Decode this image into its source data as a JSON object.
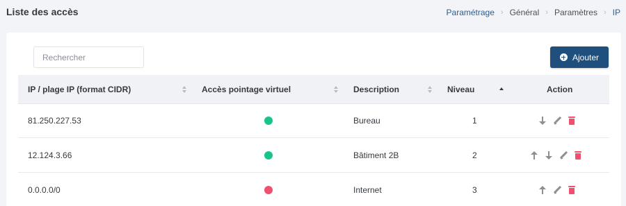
{
  "page": {
    "title": "Liste des accès",
    "breadcrumb": [
      "Paramétrage",
      "Général",
      "Paramètres",
      "IP"
    ]
  },
  "toolbar": {
    "search_placeholder": "Rechercher",
    "add_label": "Ajouter"
  },
  "table": {
    "columns": [
      "IP / plage IP (format CIDR)",
      "Accès pointage virtuel",
      "Description",
      "Niveau",
      "Action"
    ],
    "sorted_column": "Niveau",
    "sort_direction": "ascending",
    "rows": [
      {
        "ip": "81.250.227.53",
        "virtual_access": true,
        "description": "Bureau",
        "level": "1",
        "actions": [
          "arrow-down",
          "edit",
          "delete"
        ]
      },
      {
        "ip": "12.124.3.66",
        "virtual_access": true,
        "description": "Bâtiment 2B",
        "level": "2",
        "actions": [
          "arrow-up",
          "arrow-down",
          "edit",
          "delete"
        ]
      },
      {
        "ip": "0.0.0.0/0",
        "virtual_access": false,
        "description": "Internet",
        "level": "3",
        "actions": [
          "arrow-up",
          "edit",
          "delete"
        ]
      }
    ]
  },
  "colors": {
    "primary": "#1f4f7c",
    "status_on": "#18c48d",
    "status_off": "#f0506e",
    "delete": "#f0506e"
  }
}
